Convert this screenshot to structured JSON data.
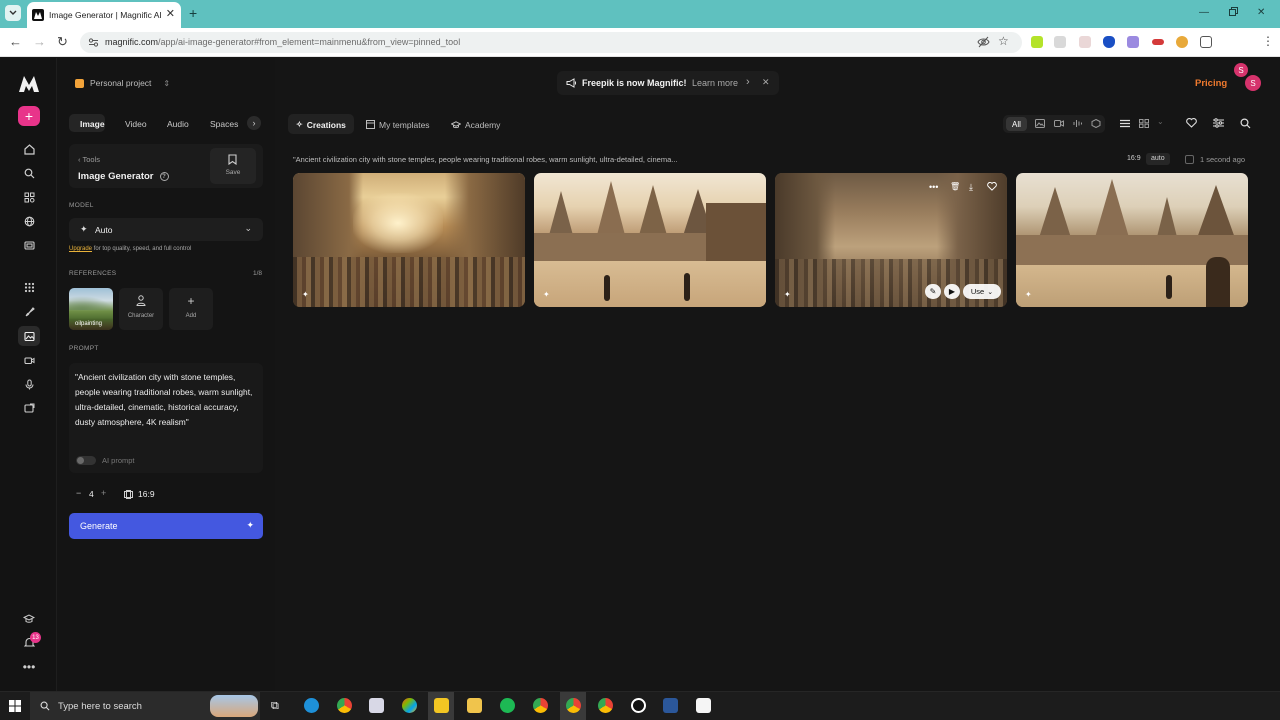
{
  "browser": {
    "tab_title": "Image Generator | Magnific AI",
    "url_main": "magnific.com",
    "url_rest": "/app/ai-image-generator#from_element=mainmenu&from_view=pinned_tool",
    "profile_initial": "S"
  },
  "header": {
    "project": "Personal project",
    "banner_text": "Freepik is now Magnific!",
    "banner_link": "Learn more",
    "pricing": "Pricing",
    "avatar_initial": "S"
  },
  "modes": [
    "Image",
    "Video",
    "Audio",
    "Spaces"
  ],
  "tool": {
    "breadcrumb": "Tools",
    "title": "Image Generator",
    "save_label": "Save"
  },
  "model": {
    "section_label": "MODEL",
    "selected": "Auto",
    "upgrade_link": "Upgrade",
    "upgrade_text": "for top quality, speed, and full control"
  },
  "references": {
    "section_label": "REFERENCES",
    "count": "1/8",
    "items": [
      {
        "label": "oilpainting"
      },
      {
        "label": "Character"
      },
      {
        "label": "Add"
      }
    ]
  },
  "prompt": {
    "section_label": "PROMPT",
    "text": "\"Ancient civilization city with stone temples, people wearing traditional robes, warm sunlight, ultra-detailed, cinematic, historical accuracy, dusty atmosphere, 4K realism\"",
    "ai_prompt_label": "AI prompt"
  },
  "controls": {
    "count": "4",
    "aspect_ratio": "16:9",
    "generate_label": "Generate"
  },
  "main_tabs": [
    "Creations",
    "My templates",
    "Academy"
  ],
  "filter_all": "All",
  "creation": {
    "prompt_preview": "\"Ancient civilization city with stone temples, people wearing traditional robes, warm sunlight, ultra-detailed, cinema...",
    "ratio": "16:9",
    "mode": "auto",
    "time": "1 second ago",
    "use_label": "Use"
  },
  "notifications": {
    "badge": "13"
  },
  "taskbar": {
    "search_placeholder": "Type here to search"
  }
}
